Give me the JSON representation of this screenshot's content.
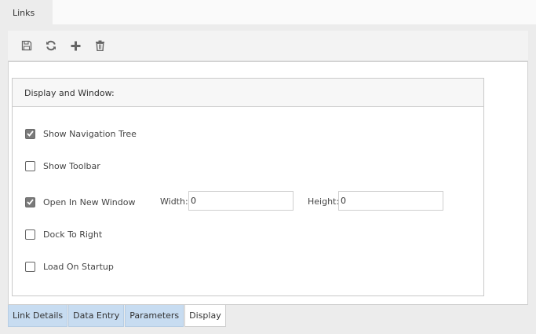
{
  "top_tab": {
    "label": "Links"
  },
  "toolbar": {
    "buttons": [
      {
        "icon": "save-icon"
      },
      {
        "icon": "refresh-icon"
      },
      {
        "icon": "add-icon"
      },
      {
        "icon": "delete-icon"
      }
    ]
  },
  "panel": {
    "title": "Display and Window:",
    "options": [
      {
        "label": "Show Navigation Tree",
        "checked": true
      },
      {
        "label": "Show Toolbar",
        "checked": false
      },
      {
        "label": "Open In New Window",
        "checked": true
      },
      {
        "label": "Dock To Right",
        "checked": false
      },
      {
        "label": "Load On Startup",
        "checked": false
      }
    ],
    "width": {
      "label": "Width:",
      "value": "0"
    },
    "height": {
      "label": "Height:",
      "value": "0"
    }
  },
  "bottom_tabs": [
    {
      "label": "Link Details",
      "active": false
    },
    {
      "label": "Data Entry",
      "active": false
    },
    {
      "label": "Parameters",
      "active": false
    },
    {
      "label": "Display",
      "active": true
    }
  ],
  "colors": {
    "tab_inactive": "#c7dcf1",
    "tab_active": "#ffffff",
    "checkbox_checked": "#7a7a7a"
  }
}
